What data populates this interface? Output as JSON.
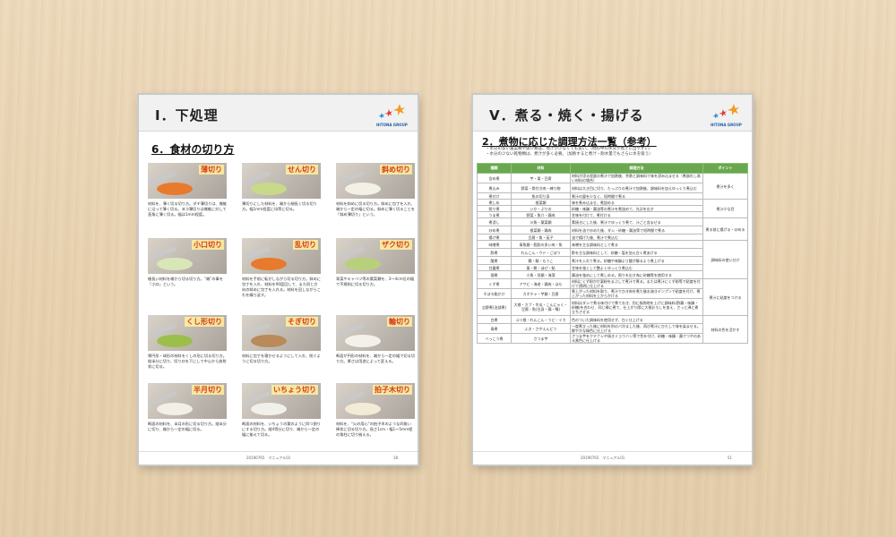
{
  "left_page": {
    "header_title": "Ⅰ．下処理",
    "logo_text": "HITONA GROUP",
    "section_title": "6．食材の切り方",
    "cuts": [
      {
        "label": "薄切り",
        "desc": "材料を、薄く切る切り方。ダチ薄切りは、繊維に沿って薄く切る。ヨコ薄切りは繊維に対して直角に薄く切る。幅は1mm程度。"
      },
      {
        "label": "せん切り",
        "desc": "薄切りにした材料を、端から細長く切る切り方。幅1mm程度に均等に切る。"
      },
      {
        "label": "斜め切り",
        "desc": "材料を斜めに切る切り方。斜めに包丁を入れ、端から一定の幅に切る。斜めに薄く切ることを「斜め薄切り」という。"
      },
      {
        "label": "小口切り",
        "desc": "細長い材料を端から切る切り方。“端”の事を「小口」という。"
      },
      {
        "label": "乱切り",
        "desc": "材料を手前に転がしながら切る切り方。斜めに包丁を入れ、材料を90度回して、また同じ方向の斜めに包丁を入れる。材料を回しながらこれを繰り返す。"
      },
      {
        "label": "ザク切り",
        "desc": "青菜やキャベツ等の葉菜類を、3〜4cm位の幅で不規則に切る切り方。"
      },
      {
        "label": "くし形切り",
        "desc": "果円形・球形の材料をくしの形に切る切り方。縦半分に切り、切り口を下にして中心から放射状に切る。"
      },
      {
        "label": "そぎ切り",
        "desc": "材料に包丁を寝かせるようにして入れ、削ぐように切る切り方。"
      },
      {
        "label": "輪切り",
        "desc": "断面が円形の材料を、端から一定の幅で切る切り方。厚さは用途によって変える。"
      },
      {
        "label": "半月切り",
        "desc": "断面の材料を、半月の形に切る切り方。縦半分に切り、端から一定の幅に切る。"
      },
      {
        "label": "いちょう切り",
        "desc": "断面の材料を、いちょうの葉のように四つ割りにする切り方。縦4等分に切り、端から一定の幅に揃えて切る。"
      },
      {
        "label": "拍子木切り",
        "desc": "材料を、“火の用心”の拍子木のような四角い棒状に切る切り方。長さ1cm・幅1〜5mm程の角柱に切り揃える。"
      }
    ],
    "footer_center": "20190765　マニュアル01",
    "footer_page": "18"
  },
  "right_page": {
    "header_title": "Ⅴ．煮る・焼く・揚げる",
    "logo_text": "HITONA GROUP",
    "section_title": "2．煮物に応じた調理方法一覧（参考）",
    "notes": [
      "・水分の多い葉菜類や魚介類は、煮汁が少なくても良い。（材料中の水分が煮汁に出やすい）",
      "・水分の少ない乾物類は、煮汁が多く必要。（加熱すると煮汁・耐水量でもさらに水を吸う）"
    ],
    "table_headers": [
      "種類",
      "材料",
      "調理方法",
      "ポイント"
    ],
    "rows": [
      {
        "type": "含め煮",
        "material": "芋・栗・豆腐",
        "method": "材料が浸る程度の煮汁で加熱後、余熱と調味料で味を浸み込ませる（煮崩れし易い材料の場合）"
      },
      {
        "type": "煮込み",
        "material": "野菜・骨付き肉・練り物",
        "method": "材料は大き目に切り、たっぷりの煮汁で加熱後、調味料を加えゆっくり煮込む"
      },
      {
        "type": "煮付け",
        "material": "魚の切り身",
        "method": "煮汁の量を少なく、短時間で煮る"
      },
      {
        "type": "煮しめ",
        "material": "根菜類",
        "method": "味を煮み込ませ、煮詰める"
      },
      {
        "type": "照り煮",
        "material": "いか・ぶりの",
        "method": "砂糖・味醂・醤油等の煮汁を煮詰めて、光沢を出す"
      },
      {
        "type": "うま煮",
        "material": "野菜・魚介・鶏肉",
        "method": "甘味を付けて、煮付ける"
      },
      {
        "type": "煮浸し",
        "material": "川魚・葉菜類",
        "method": "素焼きにした後、煮汁でゆっくり煮て、汁ごと含ませる"
      },
      {
        "type": "炒め煮",
        "material": "根菜類・鶏肉",
        "method": "材料を油で炒めた後、ダシ・砂糖・醤油等で短時間で煮る"
      },
      {
        "type": "揚げ煮",
        "material": "豆腐・魚・茄子",
        "method": "油で揚げた後、煮汁で煮込む"
      },
      {
        "type": "味噌煮",
        "material": "青魚類・脂肪の多い肉・魚",
        "method": "味噌を主な調味料として煮る"
      },
      {
        "type": "酢煮",
        "material": "れんこん・ウド・ごぼう",
        "method": "酢を主な調味料として、砂糖・塩を加え白く煮あげる"
      },
      {
        "type": "酸煮",
        "material": "鯖・鰯・もうこ",
        "method": "煮汁を入れて煮る。砂糖や味醂より酸が勝るよう煮上げる"
      },
      {
        "type": "甘露煮",
        "material": "栗・鮒・ほぜ・鮎",
        "method": "甘味を強くして艶よくゆっくり煮込む"
      },
      {
        "type": "佃煮",
        "material": "小魚・貝類・海藻",
        "method": "醤油を強めにして煮しめる。照りを出す為に砂糖等を使用する"
      },
      {
        "type": "くず煮",
        "material": "アワビ・海老・鶏肉・はも",
        "method": "材料にくず粉か片栗粉をまぶして煮汁で煮る。または煮汁にくず粉等で粘度を付けて透明に仕上げる"
      },
      {
        "type": "そぼろ餡かけ",
        "material": "カボチャ・芋類・豆腐",
        "method": "煮上がった材料を取り、煮汁でひき肉を煮た後水溶きデンプンで粘度を付け、煮上がった材料を上からかける"
      },
      {
        "type": "吉野煮(治部煮)",
        "material": "大根・カブ・冬瓜・こんにゃく・豆腐・魚(白身・鶏・鴨)",
        "method": "材料はダシで煮る味付けで煮ておき、別に吸物地を上げに調味料(酢醤・味醂・砂糖)を合わせ、同じ様に煮て、仕上がり際に大根おろしを加え、さっと沸と煮立ちさせる"
      },
      {
        "type": "白煮",
        "material": "ユリ根・れんこん・うど・イカ",
        "method": "色のついた調味料を使用せず、白く仕上げる"
      },
      {
        "type": "青煮",
        "material": "ふき・さやえんどう",
        "method": "一度煮立った後に材料を別のバ冷ました後、再び煮汁にひたして味を染ませる。鮮やかな緑色に仕上げる"
      },
      {
        "type": "べっこう煮",
        "material": "さつま芋",
        "method": "さつま芋をクチナシや焼きミョウバン等で色を付け、砂糖・味醂・醤でつやのある黄色に仕上げる"
      }
    ],
    "points": [
      "煮汁を多く",
      "煮汁少な目",
      "煮る前に揚げる・炒める",
      "調味料の使い分け",
      "煮汁に粘度をつける",
      "材料の色を活かす"
    ],
    "footer_center": "20190765　マニュアル01",
    "footer_page": "51"
  }
}
